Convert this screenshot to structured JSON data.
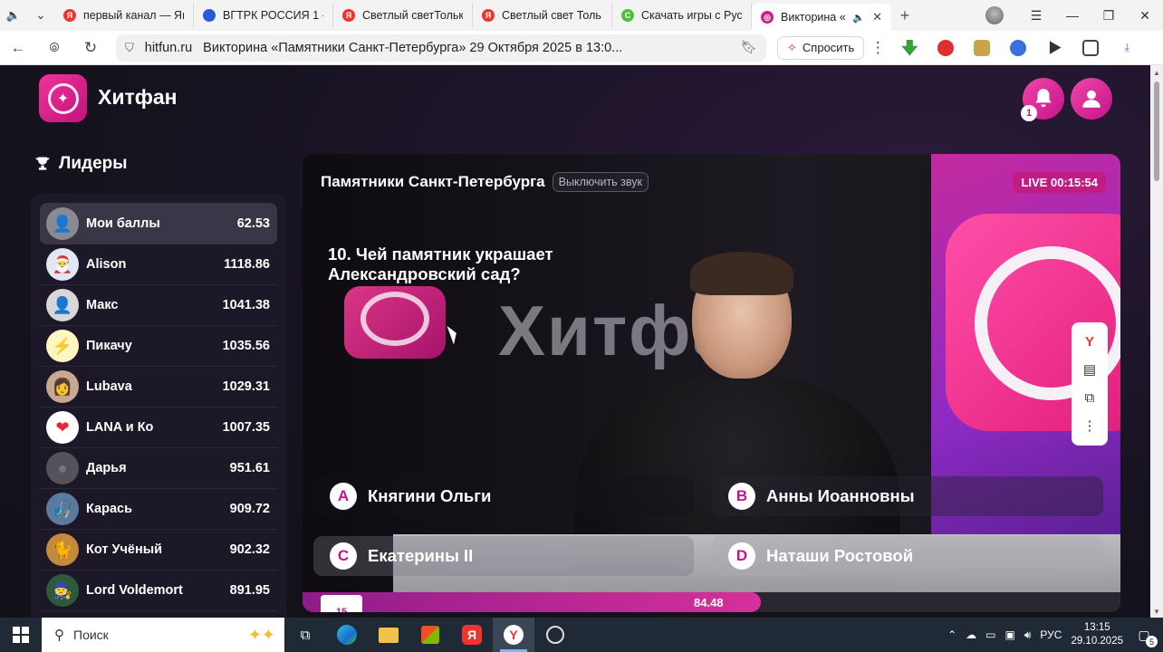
{
  "browser": {
    "tabs": [
      {
        "title": "первый канал — Ян",
        "favicon_color": "#f0332b",
        "favicon_glyph": "Я"
      },
      {
        "title": "ВГТРК РОССИЯ 1 -",
        "favicon_color": "#2a5bd7",
        "favicon_glyph": ""
      },
      {
        "title": "Светлый светТольк",
        "favicon_color": "#f0332b",
        "favicon_glyph": "Я"
      },
      {
        "title": "Светлый свет Толь",
        "favicon_color": "#f0332b",
        "favicon_glyph": "Я"
      },
      {
        "title": "Скачать игры с Рус",
        "favicon_color": "#4fbf3a",
        "favicon_glyph": "C"
      },
      {
        "title": "Викторина «П",
        "favicon_color": "#d11c8c",
        "favicon_glyph": "◎"
      }
    ],
    "active_tab_index": 5,
    "url_domain": "hitfun.ru",
    "page_title": "Викторина «Памятники Санкт-Петербурга» 29 Октября 2025 в 13:0...",
    "ask_label": "Спросить"
  },
  "site": {
    "brand": "Хитфан",
    "notifications_count": "1",
    "accent": "#d6309a"
  },
  "leaders": {
    "title": "Лидеры",
    "rows": [
      {
        "name": "Мои баллы",
        "score": "62.53",
        "avatar_bg": "#8a8a92",
        "avatar_glyph": "👤",
        "me": true
      },
      {
        "name": "Alison",
        "score": "1118.86",
        "avatar_bg": "#dfe8f4",
        "avatar_glyph": "🎅"
      },
      {
        "name": "Макс",
        "score": "1041.38",
        "avatar_bg": "#d7d7d9",
        "avatar_glyph": "👤"
      },
      {
        "name": "Пикачу",
        "score": "1035.56",
        "avatar_bg": "#fff7c2",
        "avatar_glyph": "⚡"
      },
      {
        "name": "Lubava",
        "score": "1029.31",
        "avatar_bg": "#c8a890",
        "avatar_glyph": "👩"
      },
      {
        "name": "LANA и Ко",
        "score": "1007.35",
        "avatar_bg": "#ffffff",
        "avatar_glyph": "❤"
      },
      {
        "name": "Дарья",
        "score": "951.61",
        "avatar_bg": "#55525c",
        "avatar_glyph": "●"
      },
      {
        "name": "Карась",
        "score": "909.72",
        "avatar_bg": "#5a7aa0",
        "avatar_glyph": "🎣"
      },
      {
        "name": "Кот Учёный",
        "score": "902.32",
        "avatar_bg": "#c48a3c",
        "avatar_glyph": "🐈"
      },
      {
        "name": "Lord Voldemort",
        "score": "891.95",
        "avatar_bg": "#2c5a3a",
        "avatar_glyph": "🧙"
      }
    ]
  },
  "quiz": {
    "title": "Памятники Санкт-Петербурга",
    "mute_label": "Выключить звук",
    "live_label": "LIVE 00:15:54",
    "question": "10. Чей памятник украшает Александровский сад?",
    "background_text": "Хитфан",
    "answers": [
      {
        "letter": "A",
        "text": "Княгини Ольги"
      },
      {
        "letter": "B",
        "text": "Анны Иоанновны"
      },
      {
        "letter": "C",
        "text": "Екатерины II"
      },
      {
        "letter": "D",
        "text": "Наташи Ростовой"
      }
    ],
    "progress_start": "15",
    "progress_value": "84.48",
    "progress_fraction": 0.56
  },
  "taskbar": {
    "search_placeholder": "Поиск",
    "language": "РУС",
    "time": "13:15",
    "date": "29.10.2025",
    "notification_count": "5"
  }
}
